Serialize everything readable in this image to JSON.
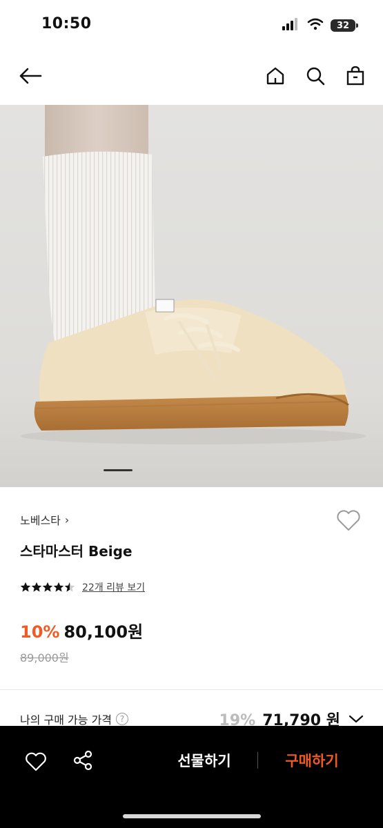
{
  "status_bar": {
    "time": "10:50",
    "battery": "32",
    "icons": [
      "signal-icon",
      "wifi-icon",
      "battery-icon"
    ]
  },
  "nav": {
    "icons": [
      "back-arrow-icon",
      "home-icon",
      "search-icon",
      "shopping-bag-icon"
    ]
  },
  "product": {
    "brand": "노베스타",
    "brand_chevron": "›",
    "title": "스타마스터 Beige",
    "rating": 4.5,
    "review_link": "22개 리뷰 보기",
    "discount": "10%",
    "price": "80,100원",
    "original_price": "89,000원"
  },
  "my_price": {
    "label": "나의 구매 가능 가격",
    "help": "?",
    "discount": "19%",
    "price": "71,790 원"
  },
  "bottom_bar": {
    "gift_label": "선물하기",
    "buy_label": "구매하기",
    "icons": [
      "heart-icon",
      "share-icon"
    ]
  },
  "colors": {
    "accent": "#f15a22",
    "bottom_bar_bg": "#000000"
  }
}
